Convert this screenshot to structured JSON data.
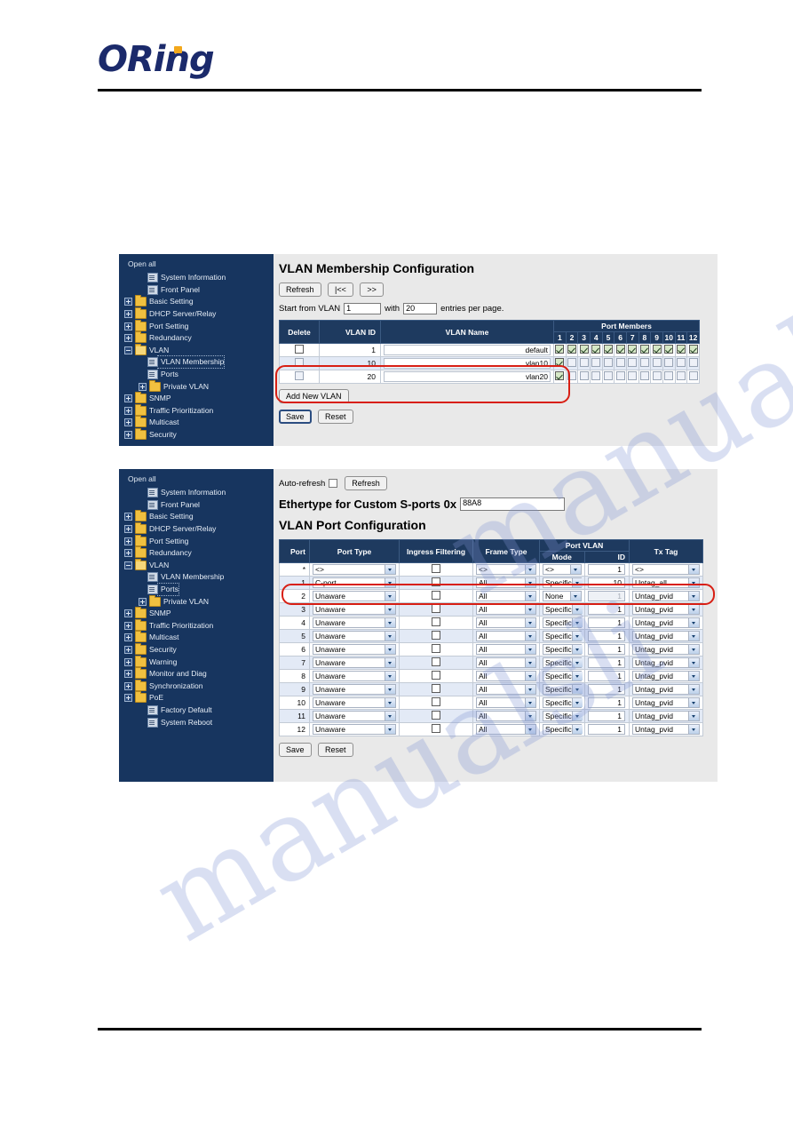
{
  "brand": {
    "name": "ORing"
  },
  "watermark": {
    "line_top": "manualslib.co",
    "line_bottom": "manualsli"
  },
  "sidebar_membership": {
    "open_all": "Open all",
    "items": [
      {
        "label": "System Information",
        "icon": "page-icon",
        "level": 2,
        "toggle": "none"
      },
      {
        "label": "Front Panel",
        "icon": "page-icon",
        "level": 2,
        "toggle": "none"
      },
      {
        "label": "Basic Setting",
        "icon": "folder-icon",
        "level": 1,
        "toggle": "plus"
      },
      {
        "label": "DHCP Server/Relay",
        "icon": "folder-icon",
        "level": 1,
        "toggle": "plus"
      },
      {
        "label": "Port Setting",
        "icon": "folder-icon",
        "level": 1,
        "toggle": "plus"
      },
      {
        "label": "Redundancy",
        "icon": "folder-icon",
        "level": 1,
        "toggle": "plus"
      },
      {
        "label": "VLAN",
        "icon": "folder-open-icon",
        "level": 1,
        "toggle": "minus"
      },
      {
        "label": "VLAN Membership",
        "icon": "page-icon",
        "level": 3,
        "toggle": "none",
        "selected": true
      },
      {
        "label": "Ports",
        "icon": "page-icon",
        "level": 3,
        "toggle": "none"
      },
      {
        "label": "Private VLAN",
        "icon": "folder-icon",
        "level": 2,
        "toggle": "plus"
      },
      {
        "label": "SNMP",
        "icon": "folder-icon",
        "level": 1,
        "toggle": "plus"
      },
      {
        "label": "Traffic Prioritization",
        "icon": "folder-icon",
        "level": 1,
        "toggle": "plus"
      },
      {
        "label": "Multicast",
        "icon": "folder-icon",
        "level": 1,
        "toggle": "plus"
      },
      {
        "label": "Security",
        "icon": "folder-icon",
        "level": 1,
        "toggle": "plus"
      }
    ]
  },
  "sidebar_ports": {
    "open_all": "Open all",
    "items": [
      {
        "label": "System Information",
        "icon": "page-icon",
        "level": 2,
        "toggle": "none"
      },
      {
        "label": "Front Panel",
        "icon": "page-icon",
        "level": 2,
        "toggle": "none"
      },
      {
        "label": "Basic Setting",
        "icon": "folder-icon",
        "level": 1,
        "toggle": "plus"
      },
      {
        "label": "DHCP Server/Relay",
        "icon": "folder-icon",
        "level": 1,
        "toggle": "plus"
      },
      {
        "label": "Port Setting",
        "icon": "folder-icon",
        "level": 1,
        "toggle": "plus"
      },
      {
        "label": "Redundancy",
        "icon": "folder-icon",
        "level": 1,
        "toggle": "plus"
      },
      {
        "label": "VLAN",
        "icon": "folder-open-icon",
        "level": 1,
        "toggle": "minus"
      },
      {
        "label": "VLAN Membership",
        "icon": "page-icon",
        "level": 3,
        "toggle": "none"
      },
      {
        "label": "Ports",
        "icon": "page-icon",
        "level": 3,
        "toggle": "none",
        "selected": true
      },
      {
        "label": "Private VLAN",
        "icon": "folder-icon",
        "level": 2,
        "toggle": "plus"
      },
      {
        "label": "SNMP",
        "icon": "folder-icon",
        "level": 1,
        "toggle": "plus"
      },
      {
        "label": "Traffic Prioritization",
        "icon": "folder-icon",
        "level": 1,
        "toggle": "plus"
      },
      {
        "label": "Multicast",
        "icon": "folder-icon",
        "level": 1,
        "toggle": "plus"
      },
      {
        "label": "Security",
        "icon": "folder-icon",
        "level": 1,
        "toggle": "plus"
      },
      {
        "label": "Warning",
        "icon": "folder-icon",
        "level": 1,
        "toggle": "plus"
      },
      {
        "label": "Monitor and Diag",
        "icon": "folder-icon",
        "level": 1,
        "toggle": "plus"
      },
      {
        "label": "Synchronization",
        "icon": "folder-icon",
        "level": 1,
        "toggle": "plus"
      },
      {
        "label": "PoE",
        "icon": "folder-icon",
        "level": 1,
        "toggle": "plus"
      },
      {
        "label": "Factory Default",
        "icon": "page-icon",
        "level": 2,
        "toggle": "none"
      },
      {
        "label": "System Reboot",
        "icon": "page-icon",
        "level": 2,
        "toggle": "none"
      }
    ]
  },
  "membership_page": {
    "title": "VLAN Membership Configuration",
    "buttons": {
      "refresh": "Refresh",
      "first": "|<<",
      "next": ">>"
    },
    "paging": {
      "start_label": "Start from VLAN",
      "start_value": "1",
      "with_label": "with",
      "entries_value": "20",
      "entries_label": "entries per page."
    },
    "table": {
      "headers": {
        "delete": "Delete",
        "vlan_id": "VLAN ID",
        "vlan_name": "VLAN Name",
        "port_members": "Port Members"
      },
      "port_numbers": [
        "1",
        "2",
        "3",
        "4",
        "5",
        "6",
        "7",
        "8",
        "9",
        "10",
        "11",
        "12"
      ],
      "rows": [
        {
          "vlan_id": "1",
          "vlan_name": "default",
          "delete_checked": false,
          "ports": [
            true,
            true,
            true,
            true,
            true,
            true,
            true,
            true,
            true,
            true,
            true,
            true
          ]
        },
        {
          "vlan_id": "10",
          "vlan_name": "vlan10",
          "delete_checked": false,
          "ports": [
            true,
            false,
            false,
            false,
            false,
            false,
            false,
            false,
            false,
            false,
            false,
            false
          ]
        },
        {
          "vlan_id": "20",
          "vlan_name": "vlan20",
          "delete_checked": false,
          "ports": [
            true,
            false,
            false,
            false,
            false,
            false,
            false,
            false,
            false,
            false,
            false,
            false
          ]
        }
      ]
    },
    "add_new_vlan": "Add New VLAN",
    "save": "Save",
    "reset": "Reset"
  },
  "ports_page": {
    "auto_refresh_label": "Auto-refresh",
    "auto_refresh_checked": false,
    "refresh": "Refresh",
    "ethertype_label": "Ethertype for Custom S-ports 0x",
    "ethertype_value": "88A8",
    "title": "VLAN Port Configuration",
    "table": {
      "headers": {
        "port": "Port",
        "port_type": "Port Type",
        "ingress_filtering": "Ingress Filtering",
        "frame_type": "Frame Type",
        "port_vlan": "Port VLAN",
        "mode": "Mode",
        "id": "ID",
        "tx_tag": "Tx Tag"
      },
      "wildcard_row": {
        "port": "*",
        "port_type": "<>",
        "ingress_checked": false,
        "frame_type": "<>",
        "mode": "<>",
        "id": "1",
        "tx_tag": "<>"
      },
      "rows": [
        {
          "port": "1",
          "port_type": "C-port",
          "ingress_checked": false,
          "frame_type": "All",
          "mode": "Specific",
          "id": "10",
          "id_disabled": false,
          "tx_tag": "Untag_all"
        },
        {
          "port": "2",
          "port_type": "Unaware",
          "ingress_checked": false,
          "frame_type": "All",
          "mode": "None",
          "id": "1",
          "id_disabled": true,
          "tx_tag": "Untag_pvid"
        },
        {
          "port": "3",
          "port_type": "Unaware",
          "ingress_checked": false,
          "frame_type": "All",
          "mode": "Specific",
          "id": "1",
          "id_disabled": false,
          "tx_tag": "Untag_pvid"
        },
        {
          "port": "4",
          "port_type": "Unaware",
          "ingress_checked": false,
          "frame_type": "All",
          "mode": "Specific",
          "id": "1",
          "id_disabled": false,
          "tx_tag": "Untag_pvid"
        },
        {
          "port": "5",
          "port_type": "Unaware",
          "ingress_checked": false,
          "frame_type": "All",
          "mode": "Specific",
          "id": "1",
          "id_disabled": false,
          "tx_tag": "Untag_pvid"
        },
        {
          "port": "6",
          "port_type": "Unaware",
          "ingress_checked": false,
          "frame_type": "All",
          "mode": "Specific",
          "id": "1",
          "id_disabled": false,
          "tx_tag": "Untag_pvid"
        },
        {
          "port": "7",
          "port_type": "Unaware",
          "ingress_checked": false,
          "frame_type": "All",
          "mode": "Specific",
          "id": "1",
          "id_disabled": false,
          "tx_tag": "Untag_pvid"
        },
        {
          "port": "8",
          "port_type": "Unaware",
          "ingress_checked": false,
          "frame_type": "All",
          "mode": "Specific",
          "id": "1",
          "id_disabled": false,
          "tx_tag": "Untag_pvid"
        },
        {
          "port": "9",
          "port_type": "Unaware",
          "ingress_checked": false,
          "frame_type": "All",
          "mode": "Specific",
          "id": "1",
          "id_disabled": false,
          "tx_tag": "Untag_pvid"
        },
        {
          "port": "10",
          "port_type": "Unaware",
          "ingress_checked": false,
          "frame_type": "All",
          "mode": "Specific",
          "id": "1",
          "id_disabled": false,
          "tx_tag": "Untag_pvid"
        },
        {
          "port": "11",
          "port_type": "Unaware",
          "ingress_checked": false,
          "frame_type": "All",
          "mode": "Specific",
          "id": "1",
          "id_disabled": false,
          "tx_tag": "Untag_pvid"
        },
        {
          "port": "12",
          "port_type": "Unaware",
          "ingress_checked": false,
          "frame_type": "All",
          "mode": "Specific",
          "id": "1",
          "id_disabled": false,
          "tx_tag": "Untag_pvid"
        }
      ]
    },
    "save": "Save",
    "reset": "Reset"
  },
  "colors": {
    "sidebar_bg": "#17355f",
    "table_header_bg": "#1e3a5f",
    "panel_bg": "#e9e9e9",
    "annotation_red": "#d81f14",
    "checked_green": "#d6e8c6",
    "brand_navy": "#1b2a6b",
    "brand_orange": "#f3a81b"
  }
}
